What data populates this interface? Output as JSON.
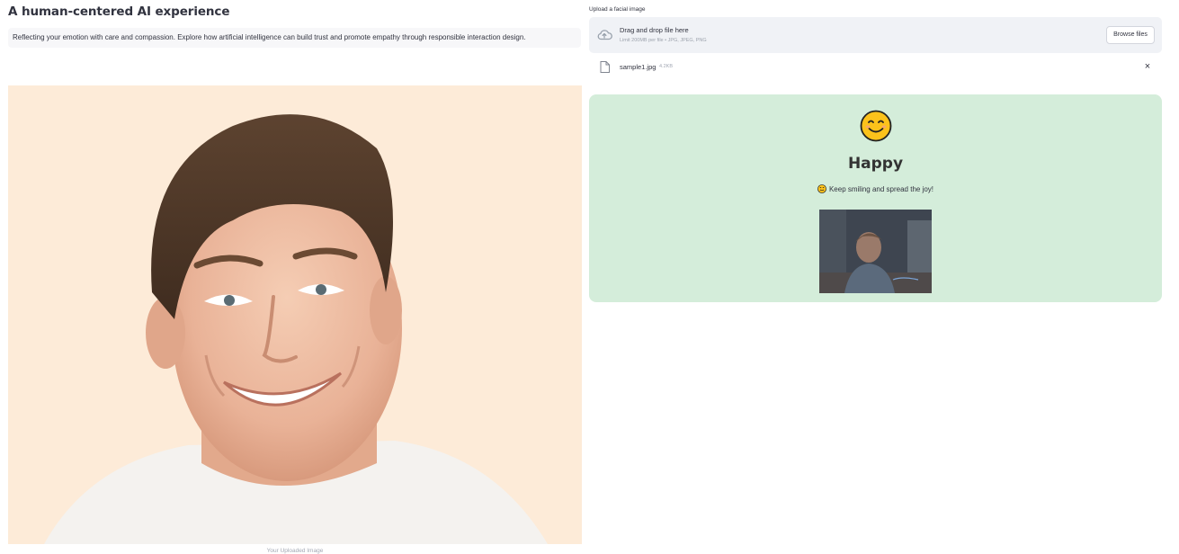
{
  "header": {
    "title": "A human-centered AI experience",
    "description": "Reflecting your emotion with care and compassion. Explore how artificial intelligence can build trust and promote empathy through responsible interaction design."
  },
  "image_panel": {
    "image": "smiling man portrait",
    "caption": "Your Uploaded Image"
  },
  "uploader": {
    "label": "Upload a facial image",
    "icon": "cloud-upload-icon",
    "drop_text": "Drag and drop file here",
    "limit_text": "Limit 200MB per file • JPG, JPEG, PNG",
    "browse_label": "Browse files",
    "file": {
      "icon": "file-icon",
      "name": "sample1.jpg",
      "size": "4.2KB",
      "remove_icon": "close-icon"
    }
  },
  "result": {
    "emoji": "smiling-face-icon",
    "emotion": "Happy",
    "message": "Keep smiling and spread the joy!",
    "image": "animated reaction gif",
    "background_color": "#d4edda"
  }
}
